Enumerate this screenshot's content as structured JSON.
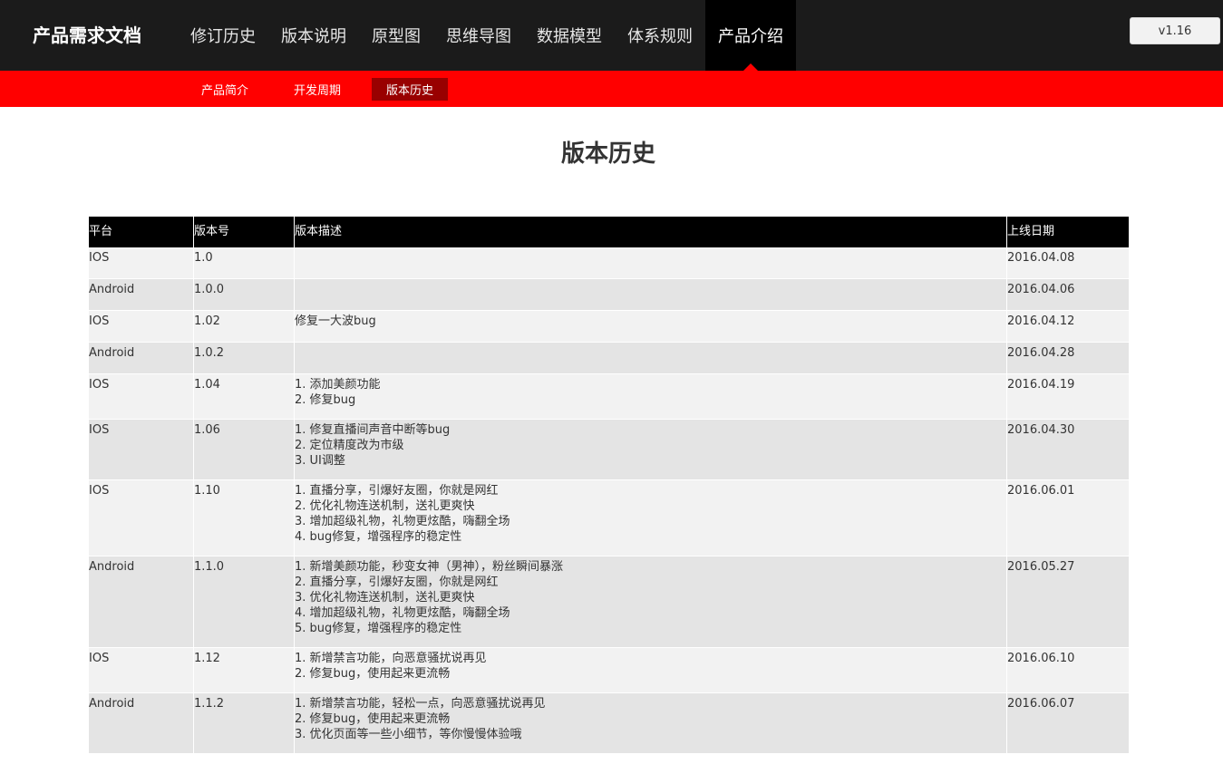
{
  "app": {
    "brand": "产品需求文档",
    "nav": [
      "修订历史",
      "版本说明",
      "原型图",
      "思维导图",
      "数据模型",
      "体系规则",
      "产品介绍"
    ],
    "version": "v1.16"
  },
  "subnav": [
    "产品简介",
    "开发周期",
    "版本历史"
  ],
  "page_title": "版本历史",
  "table": {
    "headers": [
      "平台",
      "版本号",
      "版本描述",
      "上线日期"
    ],
    "rows": [
      {
        "platform": "IOS",
        "version": "1.0",
        "desc": [],
        "date": "2016.04.08"
      },
      {
        "platform": "Android",
        "version": "1.0.0",
        "desc": [],
        "date": "2016.04.06"
      },
      {
        "platform": "IOS",
        "version": "1.02",
        "desc": [
          "修复一大波bug"
        ],
        "date": "2016.04.12"
      },
      {
        "platform": "Android",
        "version": "1.0.2",
        "desc": [],
        "date": "2016.04.28"
      },
      {
        "platform": "IOS",
        "version": "1.04",
        "desc": [
          "1. 添加美颜功能",
          "2. 修复bug"
        ],
        "date": "2016.04.19"
      },
      {
        "platform": "IOS",
        "version": "1.06",
        "desc": [
          "1. 修复直播间声音中断等bug",
          "2. 定位精度改为市级",
          "3. UI调整"
        ],
        "date": "2016.04.30"
      },
      {
        "platform": "IOS",
        "version": "1.10",
        "desc": [
          "1. 直播分享，引爆好友圈，你就是网红",
          "2. 优化礼物连送机制，送礼更爽快",
          "3. 增加超级礼物，礼物更炫酷，嗨翻全场",
          "4. bug修复，增强程序的稳定性"
        ],
        "date": "2016.06.01"
      },
      {
        "platform": "Android",
        "version": "1.1.0",
        "desc": [
          "1. 新增美颜功能，秒变女神（男神），粉丝瞬间暴涨",
          "2. 直播分享，引爆好友圈，你就是网红",
          "3. 优化礼物连送机制，送礼更爽快",
          "4. 增加超级礼物，礼物更炫酷，嗨翻全场",
          "5. bug修复，增强程序的稳定性"
        ],
        "date": "2016.05.27"
      },
      {
        "platform": "IOS",
        "version": "1.12",
        "desc": [
          "1. 新增禁言功能，向恶意骚扰说再见",
          "2. 修复bug，使用起来更流畅"
        ],
        "date": "2016.06.10"
      },
      {
        "platform": "Android",
        "version": "1.1.2",
        "desc": [
          "1. 新增禁言功能，轻松一点，向恶意骚扰说再见",
          "2. 修复bug，使用起来更流畅",
          "3. 优化页面等一些小细节，等你慢慢体验哦"
        ],
        "date": "2016.06.07"
      }
    ]
  }
}
